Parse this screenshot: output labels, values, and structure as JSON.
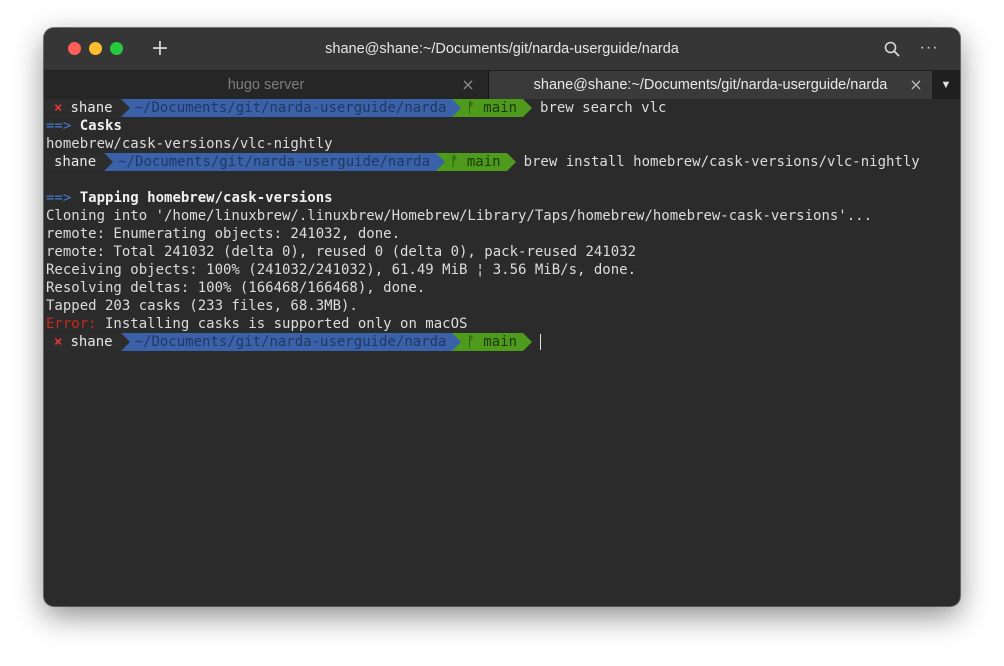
{
  "window": {
    "title": "shane@shane:~/Documents/git/narda-userguide/narda",
    "plus_glyph": "+",
    "menu_glyph": "···"
  },
  "tabs": [
    {
      "label": "hugo server",
      "close": "×"
    },
    {
      "label": "shane@shane:~/Documents/git/narda-userguide/narda",
      "close": "×"
    }
  ],
  "tab_dropdown_glyph": "▼",
  "colors": {
    "prompt_path": "#3b62a8",
    "prompt_git": "#4e9a1c",
    "error": "#c72a1f",
    "arrow": "#4a7bd0"
  },
  "terminal": {
    "prompt1": {
      "status": "×",
      "user": "shane",
      "path": "~/Documents/git/narda-userguide/narda",
      "branch": "ᚠ main",
      "command": "brew search vlc"
    },
    "casks_arrow": "==>",
    "casks_label": "Casks",
    "casks_result": "homebrew/cask-versions/vlc-nightly",
    "prompt2": {
      "user": "shane",
      "path": "~/Documents/git/narda-userguide/narda",
      "branch": "ᚠ main",
      "command": "brew install homebrew/cask-versions/vlc-nightly"
    },
    "tapping_arrow": "==>",
    "tapping_label": "Tapping homebrew/cask-versions",
    "output": [
      "Cloning into '/home/linuxbrew/.linuxbrew/Homebrew/Library/Taps/homebrew/homebrew-cask-versions'...",
      "remote: Enumerating objects: 241032, done.",
      "remote: Total 241032 (delta 0), reused 0 (delta 0), pack-reused 241032",
      "Receiving objects: 100% (241032/241032), 61.49 MiB ¦ 3.56 MiB/s, done.",
      "Resolving deltas: 100% (166468/166468), done.",
      "Tapped 203 casks (233 files, 68.3MB)."
    ],
    "error_label": "Error:",
    "error_text": " Installing casks is supported only on macOS",
    "prompt3": {
      "status": "×",
      "user": "shane",
      "path": "~/Documents/git/narda-userguide/narda",
      "branch": "ᚠ main"
    }
  }
}
